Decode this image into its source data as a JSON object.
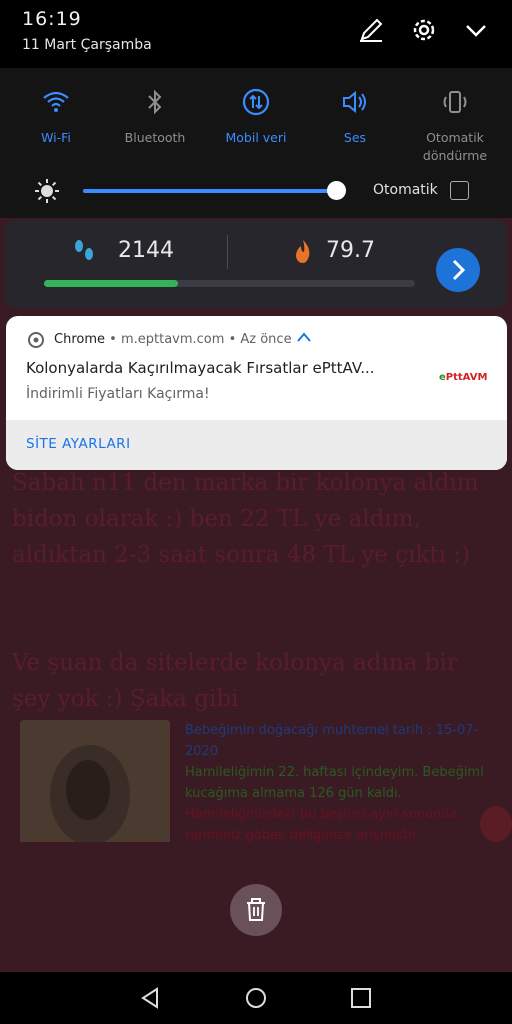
{
  "status": {
    "time": "16:19",
    "date": "11 Mart Çarşamba",
    "icons": [
      "edit-icon",
      "gear-icon",
      "chevron-down-icon"
    ]
  },
  "quick_settings": {
    "tiles": [
      {
        "label": "Wi-Fi",
        "icon": "wifi-icon",
        "active": true
      },
      {
        "label": "Bluetooth",
        "icon": "bluetooth-icon",
        "active": false
      },
      {
        "label": "Mobil veri",
        "icon": "mobile-data-icon",
        "active": true
      },
      {
        "label": "Ses",
        "icon": "sound-icon",
        "active": true
      },
      {
        "label": "Otomatik döndürme",
        "icon": "auto-rotate-icon",
        "active": false
      }
    ],
    "brightness_level": 0.95,
    "auto_brightness_label": "Otomatik",
    "accent": "#3d8cff"
  },
  "health_widget": {
    "steps": "2144",
    "calories": "79.7",
    "progress": 0.36,
    "progress_color": "#35b35a"
  },
  "notification": {
    "app": "Chrome",
    "source": "m.epttavm.com",
    "time": "Az önce",
    "title": "Kolonyalarda Kaçırılmayacak Fırsatlar ePttAV...",
    "text": "İndirimli Fiyatları Kaçırma!",
    "logo_text": "ePttAVM",
    "action": "SİTE AYARLARI",
    "action_color": "#1a73e8"
  },
  "background_post": {
    "paragraph1": "Sabah n11 den marka bir kolonya aldım bidon olarak :) ben 22 TL ye aldım, aldıktan 2-3 saat sonra 48 TL ye çıktı :)",
    "paragraph2": "Ve şuan da sitelerde kolonya adına bir şey yok :) Şaka gibi",
    "info_line1": "Bebeğimin doğacağı muhtemel tarih : 15-07-2020",
    "info_line2": "Hamileliğimin 22. haftası içindeyim. Bebeğimi kucağıma almama 126 gün kaldı.",
    "info_line3": "Hamileliğinizdeki bu beşinci ayın sonunda rahminiz göbek deliğinize erişmiştir."
  },
  "nav": {
    "icons": [
      "back-icon",
      "home-icon",
      "recents-icon"
    ]
  }
}
